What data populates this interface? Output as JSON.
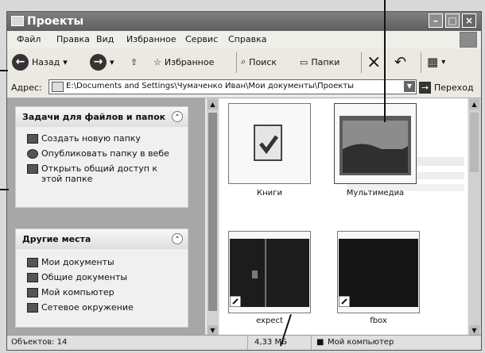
{
  "window": {
    "title": "Проекты"
  },
  "menu": [
    "Файл",
    "Правка",
    "Вид",
    "Избранное",
    "Сервис",
    "Справка"
  ],
  "toolbar": {
    "back": "Назад",
    "favorites": "Избранное",
    "search": "Поиск",
    "folders": "Папки"
  },
  "address": {
    "label": "Адрес:",
    "path": "E:\\Documents and Settings\\Чумаченко Иван\\Мои документы\\Проекты",
    "go": "Переход"
  },
  "tasks": {
    "title": "Задачи для файлов и папок",
    "items": [
      {
        "label": "Создать новую папку",
        "icon": "new-folder-icon"
      },
      {
        "label": "Опубликовать папку в вебе",
        "icon": "publish-web-icon"
      },
      {
        "label": "Открыть общий доступ к",
        "label2": "этой папке",
        "icon": "share-folder-icon"
      }
    ]
  },
  "places": {
    "title": "Другие места",
    "items": [
      {
        "label": "Мои документы",
        "icon": "my-documents-icon"
      },
      {
        "label": "Общие документы",
        "icon": "shared-documents-icon"
      },
      {
        "label": "Мой компьютер",
        "icon": "my-computer-icon"
      },
      {
        "label": "Сетевое окружение",
        "icon": "network-places-icon"
      }
    ]
  },
  "files": [
    {
      "name": "Книги",
      "type": "document"
    },
    {
      "name": "Мультимедиа",
      "type": "folder-image",
      "selected": true
    },
    {
      "name": "expect",
      "type": "shortcut"
    },
    {
      "name": "fbox",
      "type": "shortcut"
    }
  ],
  "status": {
    "objects": "Объектов: 14",
    "size": "4,33 МБ",
    "location": "Мой компьютер"
  },
  "colors": {
    "window_title": "#666666",
    "pane": "#a7a7a7",
    "task_panel": "#f0f0f0"
  }
}
